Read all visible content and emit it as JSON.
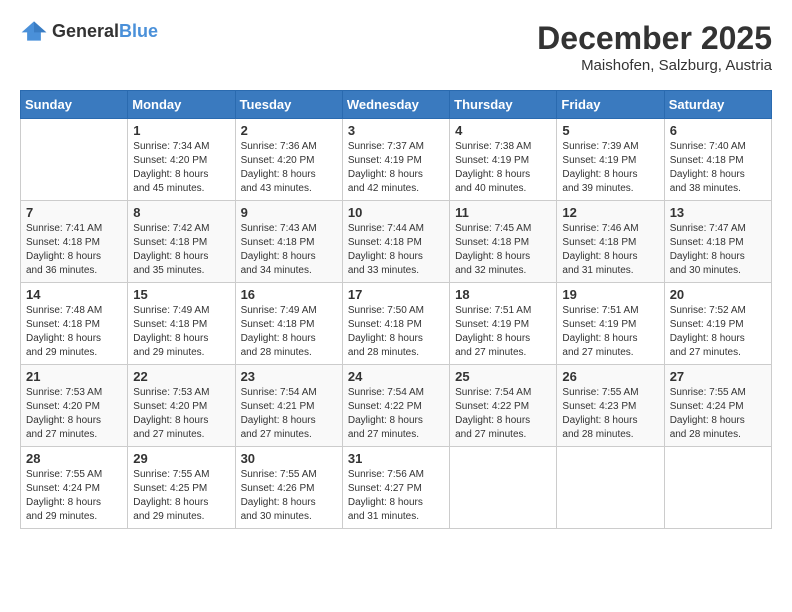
{
  "header": {
    "logo_general": "General",
    "logo_blue": "Blue",
    "month_title": "December 2025",
    "location": "Maishofen, Salzburg, Austria"
  },
  "days_of_week": [
    "Sunday",
    "Monday",
    "Tuesday",
    "Wednesday",
    "Thursday",
    "Friday",
    "Saturday"
  ],
  "weeks": [
    [
      {
        "day": "",
        "info": ""
      },
      {
        "day": "1",
        "info": "Sunrise: 7:34 AM\nSunset: 4:20 PM\nDaylight: 8 hours\nand 45 minutes."
      },
      {
        "day": "2",
        "info": "Sunrise: 7:36 AM\nSunset: 4:20 PM\nDaylight: 8 hours\nand 43 minutes."
      },
      {
        "day": "3",
        "info": "Sunrise: 7:37 AM\nSunset: 4:19 PM\nDaylight: 8 hours\nand 42 minutes."
      },
      {
        "day": "4",
        "info": "Sunrise: 7:38 AM\nSunset: 4:19 PM\nDaylight: 8 hours\nand 40 minutes."
      },
      {
        "day": "5",
        "info": "Sunrise: 7:39 AM\nSunset: 4:19 PM\nDaylight: 8 hours\nand 39 minutes."
      },
      {
        "day": "6",
        "info": "Sunrise: 7:40 AM\nSunset: 4:18 PM\nDaylight: 8 hours\nand 38 minutes."
      }
    ],
    [
      {
        "day": "7",
        "info": "Sunrise: 7:41 AM\nSunset: 4:18 PM\nDaylight: 8 hours\nand 36 minutes."
      },
      {
        "day": "8",
        "info": "Sunrise: 7:42 AM\nSunset: 4:18 PM\nDaylight: 8 hours\nand 35 minutes."
      },
      {
        "day": "9",
        "info": "Sunrise: 7:43 AM\nSunset: 4:18 PM\nDaylight: 8 hours\nand 34 minutes."
      },
      {
        "day": "10",
        "info": "Sunrise: 7:44 AM\nSunset: 4:18 PM\nDaylight: 8 hours\nand 33 minutes."
      },
      {
        "day": "11",
        "info": "Sunrise: 7:45 AM\nSunset: 4:18 PM\nDaylight: 8 hours\nand 32 minutes."
      },
      {
        "day": "12",
        "info": "Sunrise: 7:46 AM\nSunset: 4:18 PM\nDaylight: 8 hours\nand 31 minutes."
      },
      {
        "day": "13",
        "info": "Sunrise: 7:47 AM\nSunset: 4:18 PM\nDaylight: 8 hours\nand 30 minutes."
      }
    ],
    [
      {
        "day": "14",
        "info": "Sunrise: 7:48 AM\nSunset: 4:18 PM\nDaylight: 8 hours\nand 29 minutes."
      },
      {
        "day": "15",
        "info": "Sunrise: 7:49 AM\nSunset: 4:18 PM\nDaylight: 8 hours\nand 29 minutes."
      },
      {
        "day": "16",
        "info": "Sunrise: 7:49 AM\nSunset: 4:18 PM\nDaylight: 8 hours\nand 28 minutes."
      },
      {
        "day": "17",
        "info": "Sunrise: 7:50 AM\nSunset: 4:18 PM\nDaylight: 8 hours\nand 28 minutes."
      },
      {
        "day": "18",
        "info": "Sunrise: 7:51 AM\nSunset: 4:19 PM\nDaylight: 8 hours\nand 27 minutes."
      },
      {
        "day": "19",
        "info": "Sunrise: 7:51 AM\nSunset: 4:19 PM\nDaylight: 8 hours\nand 27 minutes."
      },
      {
        "day": "20",
        "info": "Sunrise: 7:52 AM\nSunset: 4:19 PM\nDaylight: 8 hours\nand 27 minutes."
      }
    ],
    [
      {
        "day": "21",
        "info": "Sunrise: 7:53 AM\nSunset: 4:20 PM\nDaylight: 8 hours\nand 27 minutes."
      },
      {
        "day": "22",
        "info": "Sunrise: 7:53 AM\nSunset: 4:20 PM\nDaylight: 8 hours\nand 27 minutes."
      },
      {
        "day": "23",
        "info": "Sunrise: 7:54 AM\nSunset: 4:21 PM\nDaylight: 8 hours\nand 27 minutes."
      },
      {
        "day": "24",
        "info": "Sunrise: 7:54 AM\nSunset: 4:22 PM\nDaylight: 8 hours\nand 27 minutes."
      },
      {
        "day": "25",
        "info": "Sunrise: 7:54 AM\nSunset: 4:22 PM\nDaylight: 8 hours\nand 27 minutes."
      },
      {
        "day": "26",
        "info": "Sunrise: 7:55 AM\nSunset: 4:23 PM\nDaylight: 8 hours\nand 28 minutes."
      },
      {
        "day": "27",
        "info": "Sunrise: 7:55 AM\nSunset: 4:24 PM\nDaylight: 8 hours\nand 28 minutes."
      }
    ],
    [
      {
        "day": "28",
        "info": "Sunrise: 7:55 AM\nSunset: 4:24 PM\nDaylight: 8 hours\nand 29 minutes."
      },
      {
        "day": "29",
        "info": "Sunrise: 7:55 AM\nSunset: 4:25 PM\nDaylight: 8 hours\nand 29 minutes."
      },
      {
        "day": "30",
        "info": "Sunrise: 7:55 AM\nSunset: 4:26 PM\nDaylight: 8 hours\nand 30 minutes."
      },
      {
        "day": "31",
        "info": "Sunrise: 7:56 AM\nSunset: 4:27 PM\nDaylight: 8 hours\nand 31 minutes."
      },
      {
        "day": "",
        "info": ""
      },
      {
        "day": "",
        "info": ""
      },
      {
        "day": "",
        "info": ""
      }
    ]
  ]
}
